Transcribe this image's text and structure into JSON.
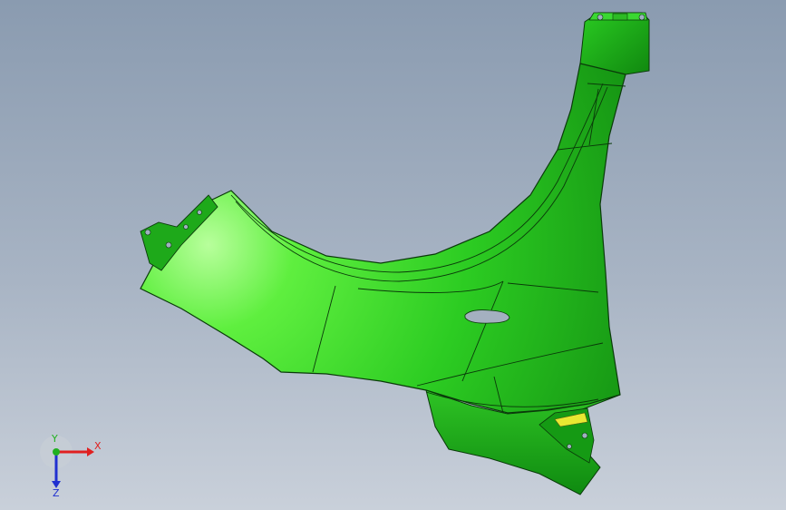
{
  "viewport": {
    "background_top": "#8a9bb0",
    "background_bottom": "#c9d0da"
  },
  "model": {
    "part_icon": "fender-3d-model",
    "body_color": "#1fbd1f",
    "highlight_color": "#9cff8a",
    "edge_color": "#0a3a0a",
    "accent_color": "#e8e832"
  },
  "triad": {
    "x_label": "X",
    "y_label": "Y",
    "z_label": "Z",
    "x_color": "#e02020",
    "y_color": "#20b020",
    "z_color": "#2030d0"
  }
}
